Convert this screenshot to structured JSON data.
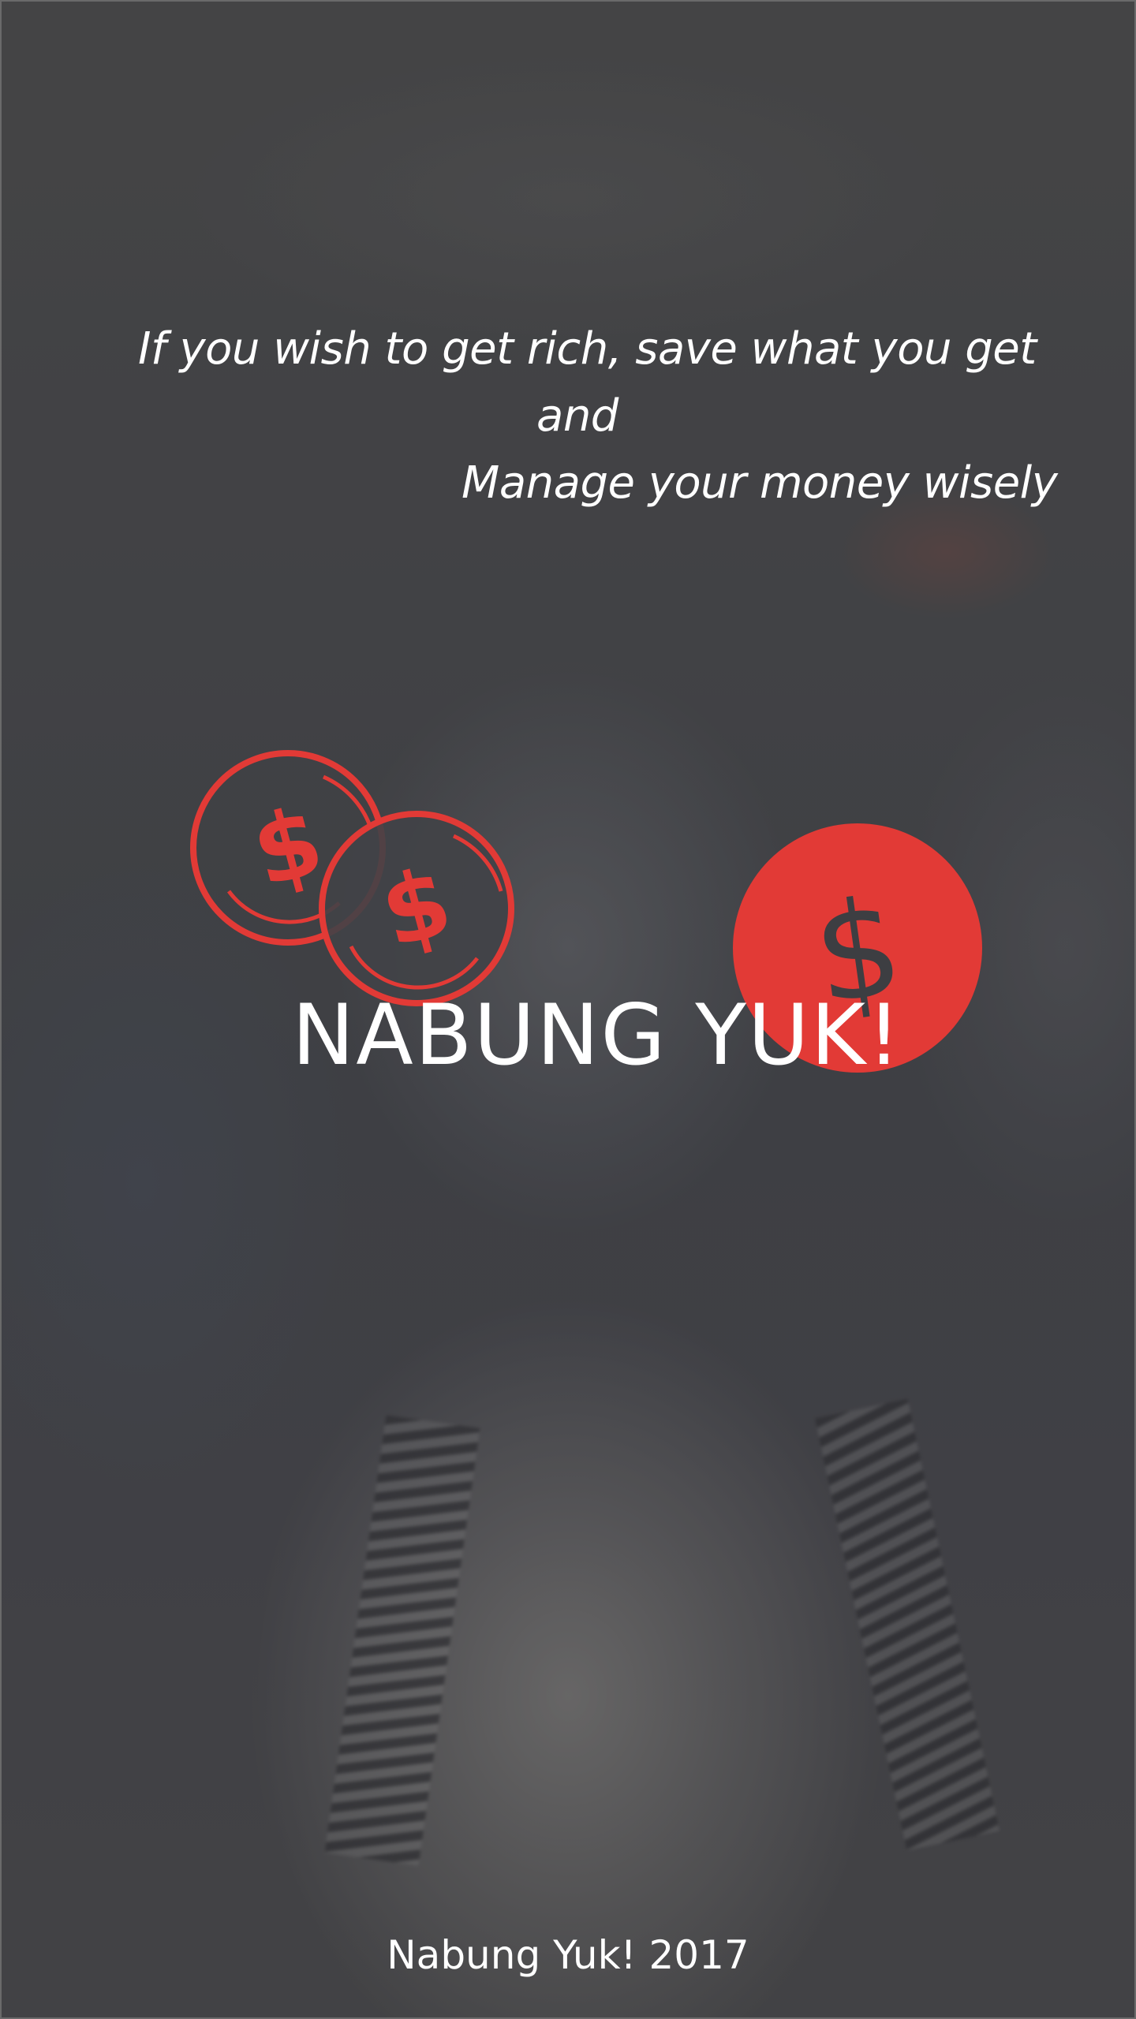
{
  "quote": {
    "line1": "If you wish to get rich, save what you get",
    "line2": "and",
    "line3": "Manage your money wisely"
  },
  "logo": {
    "title": "NABUNG YUK!",
    "coin_glyph": "$",
    "icons": [
      "coin-outline-icon",
      "coin-outline-icon",
      "coin-filled-icon"
    ],
    "accent_color": "#e23a36"
  },
  "footer": {
    "text": "Nabung Yuk! 2017"
  }
}
